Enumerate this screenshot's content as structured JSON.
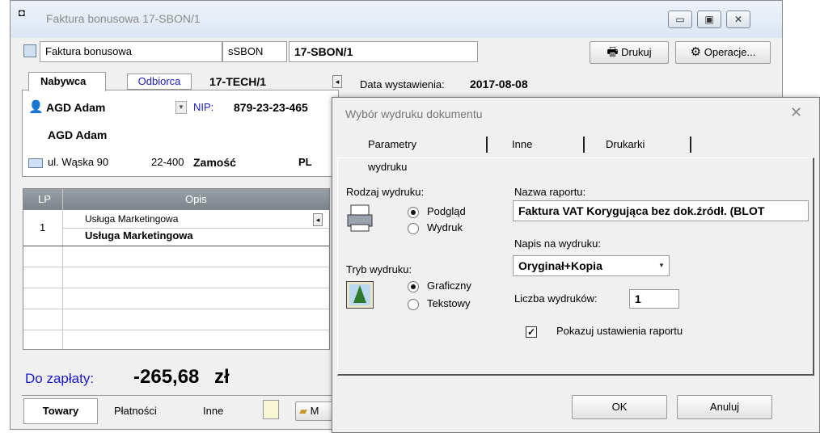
{
  "window": {
    "title": "Faktura bonusowa 17-SBON/1",
    "controls": [
      "minimize-icon",
      "maximize-icon",
      "close-icon"
    ]
  },
  "toolbar": {
    "doc_type": "Faktura bonusowa",
    "series": "sSBON",
    "number": "17-SBON/1",
    "print_label": "Drukuj",
    "operations_label": "Operacje..."
  },
  "buyer_panel": {
    "tab_buyer": "Nabywca",
    "tab_recipient": "Odbiorca",
    "code": "17-TECH/1",
    "name_short": "AGD Adam",
    "nip_label": "NIP:",
    "nip": "879-23-23-465",
    "name_full": "AGD Adam",
    "street": "ul. Wąska 90",
    "postal": "22-400",
    "city": "Zamość",
    "country": "PL"
  },
  "issue": {
    "label": "Data wystawienia:",
    "date": "2017-08-08"
  },
  "items_grid": {
    "col_lp": "LP",
    "col_desc": "Opis",
    "rows": [
      {
        "lp": "1",
        "desc": "Usługa Marketingowa",
        "desc_bold": "Usługa Marketingowa"
      }
    ]
  },
  "total": {
    "label": "Do zapłaty:",
    "amount": "-265,68",
    "currency": "zł"
  },
  "bottom_tabs": {
    "goods": "Towary",
    "payments": "Płatności",
    "other": "Inne",
    "more": "M"
  },
  "dialog": {
    "title": "Wybór wydruku dokumentu",
    "tabs": [
      "Parametry wydruku",
      "Inne",
      "Drukarki"
    ],
    "print_type_label": "Rodzaj wydruku:",
    "opt_preview": "Podgląd",
    "opt_print": "Wydruk",
    "mode_label": "Tryb wydruku:",
    "opt_graphic": "Graficzny",
    "opt_text": "Tekstowy",
    "report_name_label": "Nazwa raportu:",
    "report_name": "Faktura VAT Korygująca bez dok.źródł. (BLOT",
    "caption_label": "Napis na wydruku:",
    "caption_value": "Oryginał+Kopia",
    "copies_label": "Liczba wydruków:",
    "copies_value": "1",
    "show_settings_label": "Pokazuj ustawienia raportu",
    "ok_label": "OK",
    "cancel_label": "Anuluj"
  }
}
